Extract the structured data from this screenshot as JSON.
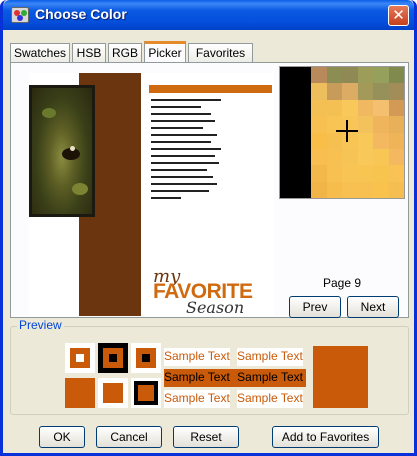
{
  "window": {
    "title": "Choose Color",
    "close_label": "✕"
  },
  "tabs": [
    {
      "label": "Swatches",
      "active": false
    },
    {
      "label": "HSB",
      "active": false
    },
    {
      "label": "RGB",
      "active": false
    },
    {
      "label": "Picker",
      "active": true
    },
    {
      "label": "Favorites",
      "active": false
    }
  ],
  "picker": {
    "artwork_my": "my",
    "artwork_favorite": "FAVORITE",
    "artwork_season": "Season",
    "page_label": "Page 9",
    "prev_label": "Prev",
    "next_label": "Next",
    "zoom_colors": [
      "#000000",
      "#000000",
      "#b8895a",
      "#8c8d52",
      "#8f8a55",
      "#9c9d58",
      "#94a05c",
      "#7f8a4c",
      "#000000",
      "#000000",
      "#ecbf5c",
      "#c79c5a",
      "#dcac64",
      "#a39a5a",
      "#96905a",
      "#a28c58",
      "#000000",
      "#000000",
      "#f4c054",
      "#f4c054",
      "#f8c85a",
      "#f0b860",
      "#f4c070",
      "#d39a55",
      "#000000",
      "#000000",
      "#f8c050",
      "#f8c454",
      "#f8c658",
      "#f4c25c",
      "#efb45c",
      "#e8b058",
      "#000000",
      "#000000",
      "#f8be48",
      "#f6c050",
      "#f8c454",
      "#f8c858",
      "#f4b860",
      "#f0b458",
      "#000000",
      "#000000",
      "#f8be50",
      "#f8c050",
      "#f6c454",
      "#f8c858",
      "#f8c654",
      "#f4b860",
      "#000000",
      "#000000",
      "#f2b84a",
      "#f8c050",
      "#f8c454",
      "#f8c452",
      "#f8c450",
      "#f8c254",
      "#000000",
      "#000000",
      "#f0b448",
      "#f6bc4c",
      "#f8c050",
      "#f8c050",
      "#f8c24c",
      "#f4be50"
    ]
  },
  "preview": {
    "legend": "Preview",
    "samples": [
      {
        "text": "Sample Text",
        "bg": "#ffffff",
        "fg": "#c85a09"
      },
      {
        "text": "Sample Text",
        "bg": "#ffffff",
        "fg": "#c85a09"
      },
      {
        "text": "Sample Text",
        "bg": "#c85a09",
        "fg": "#000000"
      },
      {
        "text": "Sample Text",
        "bg": "#c85a09",
        "fg": "#000000"
      },
      {
        "text": "Sample Text",
        "bg": "#ffffff",
        "fg": "#c85a09"
      },
      {
        "text": "Sample Text",
        "bg": "#ffffff",
        "fg": "#c85a09"
      }
    ],
    "selected_color": "#c85a09"
  },
  "footer": {
    "ok_label": "OK",
    "cancel_label": "Cancel",
    "reset_label": "Reset",
    "add_favorites_label": "Add to Favorites"
  }
}
